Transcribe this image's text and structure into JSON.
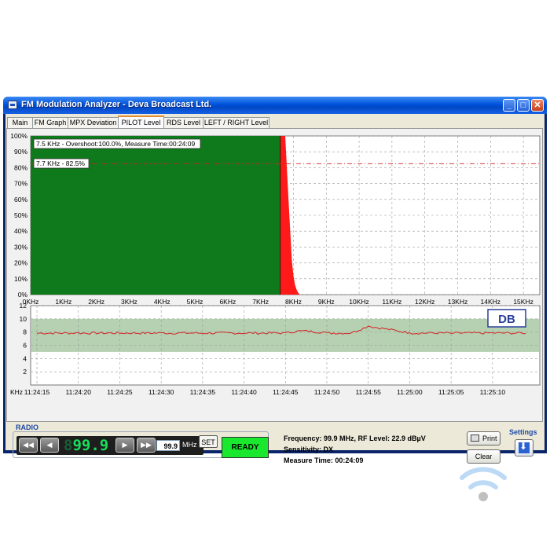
{
  "window": {
    "title": "FM Modulation Analyzer - Deva Broadcast Ltd.",
    "min_glyph": "_",
    "max_glyph": "□",
    "close_glyph": "✕"
  },
  "tabs": [
    {
      "label": "Main",
      "active": false
    },
    {
      "label": "FM Graph",
      "active": false
    },
    {
      "label": "MPX Deviation",
      "active": false
    },
    {
      "label": "PILOT Level",
      "active": true
    },
    {
      "label": "RDS Level",
      "active": false
    },
    {
      "label": "LEFT / RIGHT Level",
      "active": false
    }
  ],
  "chart_data": [
    {
      "type": "area",
      "y_ticks": [
        "100%",
        "90%",
        "80%",
        "70%",
        "60%",
        "50%",
        "40%",
        "30%",
        "20%",
        "10%",
        "0%"
      ],
      "ylim": [
        0,
        100
      ],
      "x_ticks": [
        "0KHz",
        "1KHz",
        "2KHz",
        "3KHz",
        "4KHz",
        "5KHz",
        "6KHz",
        "7KHz",
        "8KHz",
        "9KHz",
        "10KHz",
        "11KHz",
        "12KHz",
        "13KHz",
        "14KHz",
        "15KHz"
      ],
      "xlim": [
        0,
        15.5
      ],
      "grid": true,
      "annotations": [
        {
          "text": "7.5 KHz - Overshoot:100.0%, Measure Time:00:24:09"
        },
        {
          "text": "7.7 KHz - 82.5%"
        }
      ],
      "threshold_line": {
        "y": 82.5,
        "color": "#d32020"
      },
      "series": [
        {
          "color": "#0f7a1b",
          "x": [
            0,
            7.6
          ],
          "y": [
            100,
            100
          ]
        },
        {
          "color": "#ff1a1a",
          "x": [
            7.6,
            7.75,
            7.85,
            7.95,
            8.0,
            8.05,
            8.1,
            8.15,
            8.2
          ],
          "y": [
            100,
            100,
            60,
            22,
            12,
            6,
            3,
            1,
            0
          ]
        }
      ],
      "colors": {
        "fill_green": "#0f7a1b",
        "fill_red": "#ff1a1a",
        "background": "#ffffff"
      }
    },
    {
      "type": "line",
      "ylabel": "KHz",
      "y_ticks": [
        "12",
        "10",
        "8",
        "6",
        "4",
        "2"
      ],
      "ylim": [
        0,
        12
      ],
      "x_ticks": [
        "11:24:15",
        "11:24:20",
        "11:24:25",
        "11:24:30",
        "11:24:35",
        "11:24:40",
        "11:24:45",
        "11:24:50",
        "11:24:55",
        "11:25:00",
        "11:25:05",
        "11:25:10"
      ],
      "band": [
        5,
        10
      ],
      "grid": true,
      "series": [
        {
          "color": "#d32020",
          "x": [
            "11:24:15",
            "11:24:20",
            "11:24:25",
            "11:24:30",
            "11:24:35",
            "11:24:40",
            "11:24:45",
            "11:24:47",
            "11:24:50",
            "11:24:53",
            "11:24:55",
            "11:25:00",
            "11:25:05",
            "11:25:10",
            "11:25:14"
          ],
          "y": [
            7.8,
            7.9,
            7.8,
            7.9,
            7.8,
            7.8,
            7.9,
            8.2,
            7.9,
            7.9,
            8.9,
            7.9,
            7.8,
            7.9,
            7.8
          ]
        }
      ]
    }
  ],
  "logo_text": "DB",
  "radio": {
    "title": "RADIO",
    "display_freq": "99.9",
    "display_digit_prefix": "8",
    "freq_value": "99.9",
    "unit": "MHz",
    "set_label": "SET",
    "btn_prev_far": "◀◀",
    "btn_prev": "◀",
    "btn_next": "▶",
    "btn_next_far": "▶▶"
  },
  "status": {
    "ready_label": "READY"
  },
  "info": {
    "frequency_line": "Frequency: 99.9 MHz, RF Level: 22.9 dBµV",
    "sensitivity_line": "Sensitivity: DX",
    "measure_line": "Measure Time: 00:24:09"
  },
  "buttons": {
    "print_label": "Print",
    "clear_label": "Clear"
  },
  "settings": {
    "title": "Settings"
  },
  "wifi_icon_color": "#bcd9f5"
}
